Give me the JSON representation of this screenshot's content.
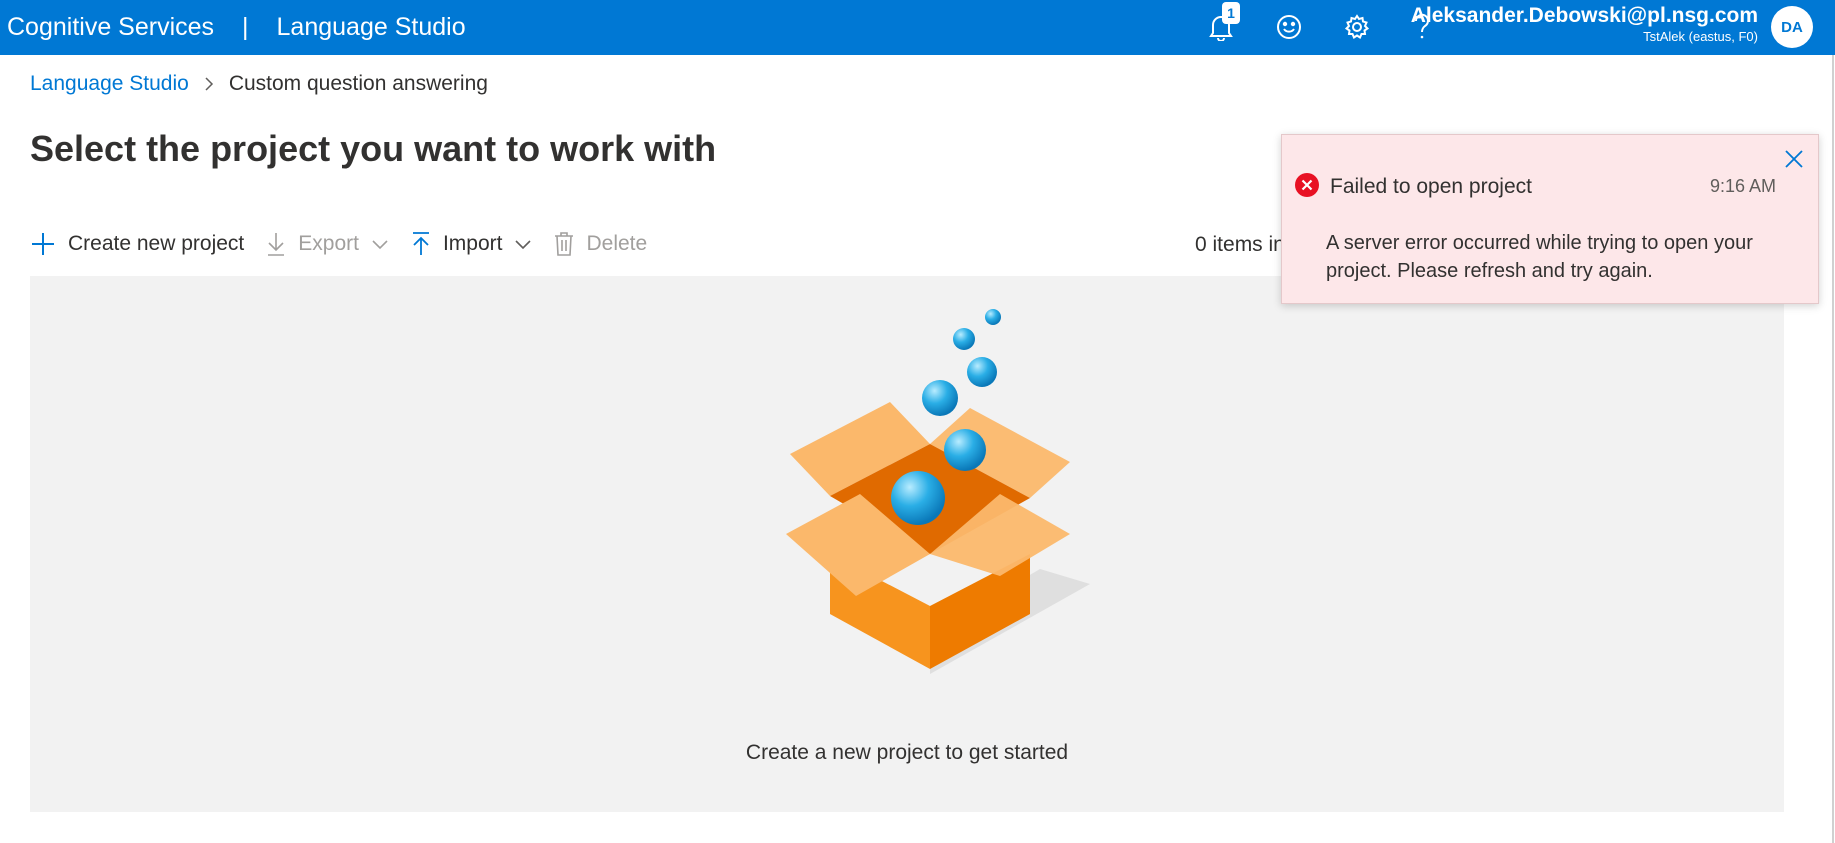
{
  "header": {
    "brand": "Cognitive Services",
    "separator": "|",
    "product": "Language Studio",
    "notification_count": "1",
    "user_email": "Aleksander.Debowski@pl.nsg.com",
    "tenant": "TstAlek (eastus, F0)",
    "avatar_initials": "DA",
    "icons": [
      "bell-icon",
      "smiley-icon",
      "gear-icon",
      "help-icon"
    ]
  },
  "breadcrumb": {
    "root": "Language Studio",
    "current": "Custom question answering"
  },
  "page": {
    "title": "Select the project you want to work with"
  },
  "toolbar": {
    "create": "Create new project",
    "export": "Export",
    "import": "Import",
    "delete": "Delete",
    "count": "0 items in"
  },
  "empty_state": {
    "message": "Create a new project to get started"
  },
  "toast": {
    "title": "Failed to open project",
    "time": "9:16 AM",
    "message": "A server error occurred while trying to open your project. Please refresh and try again.",
    "status_color": "#e81123"
  },
  "colors": {
    "accent": "#0078d4",
    "toast_background": "#fde7e9",
    "empty_background": "#f2f2f2",
    "box_orange": "#f7941e"
  }
}
